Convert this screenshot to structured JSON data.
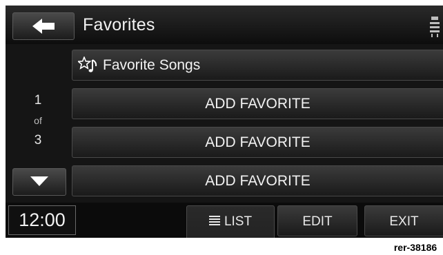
{
  "header": {
    "title": "Favorites",
    "back_icon": "back-arrow-icon",
    "settings_icon": "seat-settings-icon"
  },
  "pager": {
    "current": "1",
    "of_label": "of",
    "total": "3"
  },
  "list": {
    "title_item": {
      "label": "Favorite Songs",
      "icon": "favorite-music-icon"
    },
    "items": [
      {
        "label": "ADD FAVORITE"
      },
      {
        "label": "ADD FAVORITE"
      },
      {
        "label": "ADD FAVORITE"
      }
    ]
  },
  "footer": {
    "clock": "12:00",
    "list_label": "LIST",
    "edit_label": "EDIT",
    "exit_label": "EXIT"
  },
  "watermark": "rer-38186",
  "colors": {
    "background": "#151515",
    "button": "#2b2b2b",
    "text": "#f2f2f2"
  }
}
